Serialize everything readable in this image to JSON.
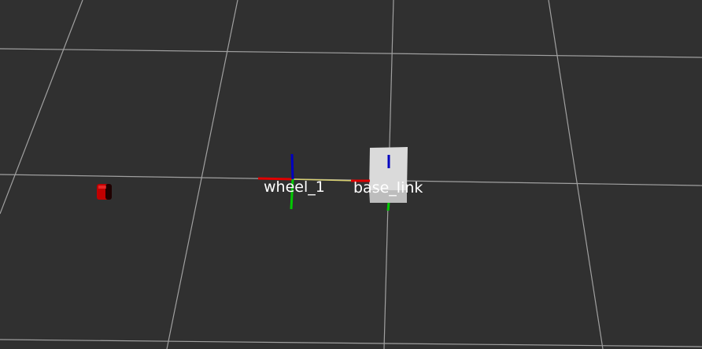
{
  "view": {
    "background_color": "#303030",
    "grid_color": "#a0a0a0"
  },
  "frames": [
    {
      "name": "wheel_1",
      "label": "wheel_1",
      "type": "tf-axes"
    },
    {
      "name": "base_link",
      "label": "base_link",
      "type": "tf-axes"
    }
  ],
  "axis_colors": {
    "x": "#e00000",
    "y": "#00c800",
    "z": "#0000c0"
  },
  "link_line_color": "#d8d070",
  "objects": [
    {
      "name": "wheel-model",
      "shape": "cylinder",
      "color": "#d00000"
    },
    {
      "name": "base-link-box",
      "shape": "box",
      "color": "#d8d8d8"
    }
  ]
}
